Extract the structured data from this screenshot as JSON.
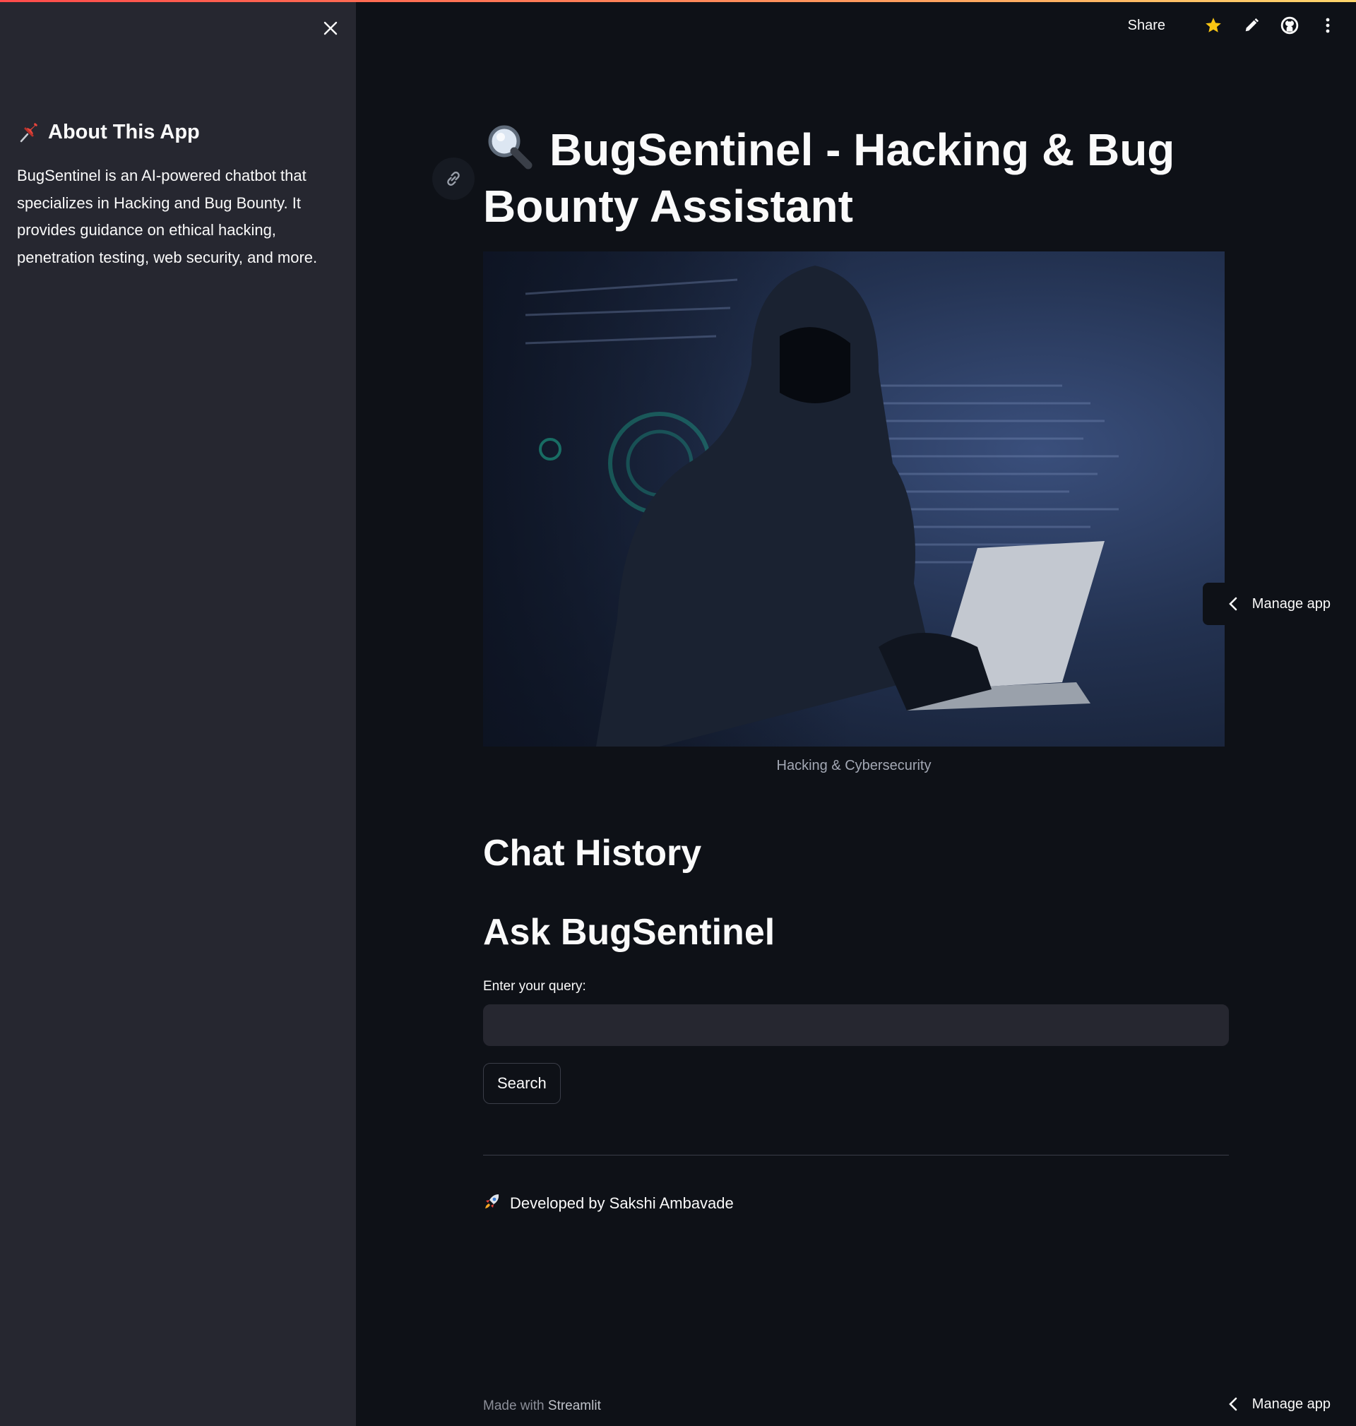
{
  "sidebar": {
    "close_icon": "close-icon",
    "header_icon": "pushpin-icon",
    "title": "About This App",
    "description": "BugSentinel is an AI-powered chatbot that specializes in Hacking and Bug Bounty. It provides guidance on ethical hacking, penetration testing, web security, and more."
  },
  "toolbar": {
    "share_label": "Share",
    "icons": [
      "star-icon",
      "pencil-icon",
      "github-icon",
      "more-vertical-icon"
    ],
    "star_color": "#f9c513"
  },
  "main": {
    "title_icon": "magnifier-icon",
    "title": "BugSentinel - Hacking & Bug Bounty Assistant",
    "hero_image_caption": "Hacking & Cybersecurity",
    "chat_history_heading": "Chat History",
    "ask_heading": "Ask BugSentinel",
    "query_label": "Enter your query:",
    "query_value": "",
    "search_button": "Search",
    "credit_icon": "rocket-icon",
    "credit": "Developed by Sakshi Ambavade",
    "made_with_prefix": "Made with",
    "made_with_brand": "Streamlit"
  },
  "manage_app": {
    "label": "Manage app",
    "icon": "chevron-left-icon"
  },
  "colors": {
    "background": "#0e1117",
    "sidebar": "#262730",
    "accent_start": "#ff4b4b",
    "accent_end": "#ffd66b"
  }
}
